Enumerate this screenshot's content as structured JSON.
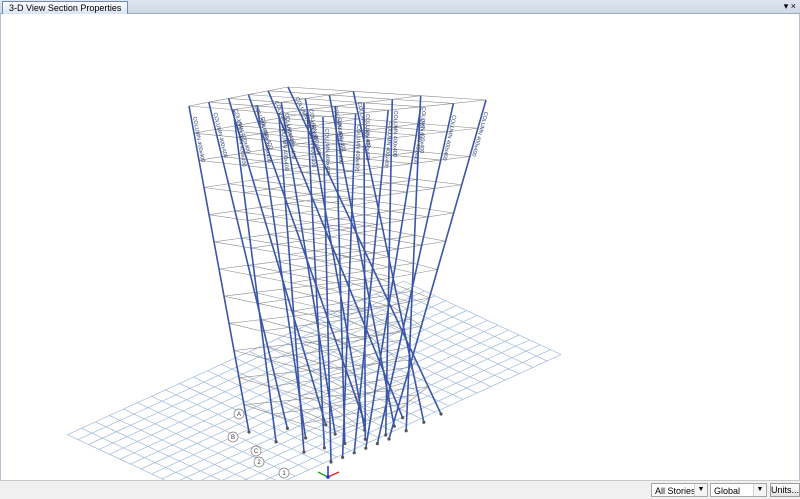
{
  "tabs": [
    {
      "label": "3-D View  Section Properties"
    }
  ],
  "window": {
    "close_glyph": "×",
    "pin_glyph": "▾"
  },
  "model": {
    "column_label": "COLUMN 400x400",
    "grid_bubbles": [
      "A",
      "B",
      "C",
      "2",
      "1"
    ]
  },
  "status": {
    "stories_select": "All Stories",
    "coord_select": "Global",
    "units_button": "Units..."
  },
  "colors": {
    "column": "#3a56a8",
    "grid": "#9fb9d9",
    "floor": "#8a8a8a"
  }
}
